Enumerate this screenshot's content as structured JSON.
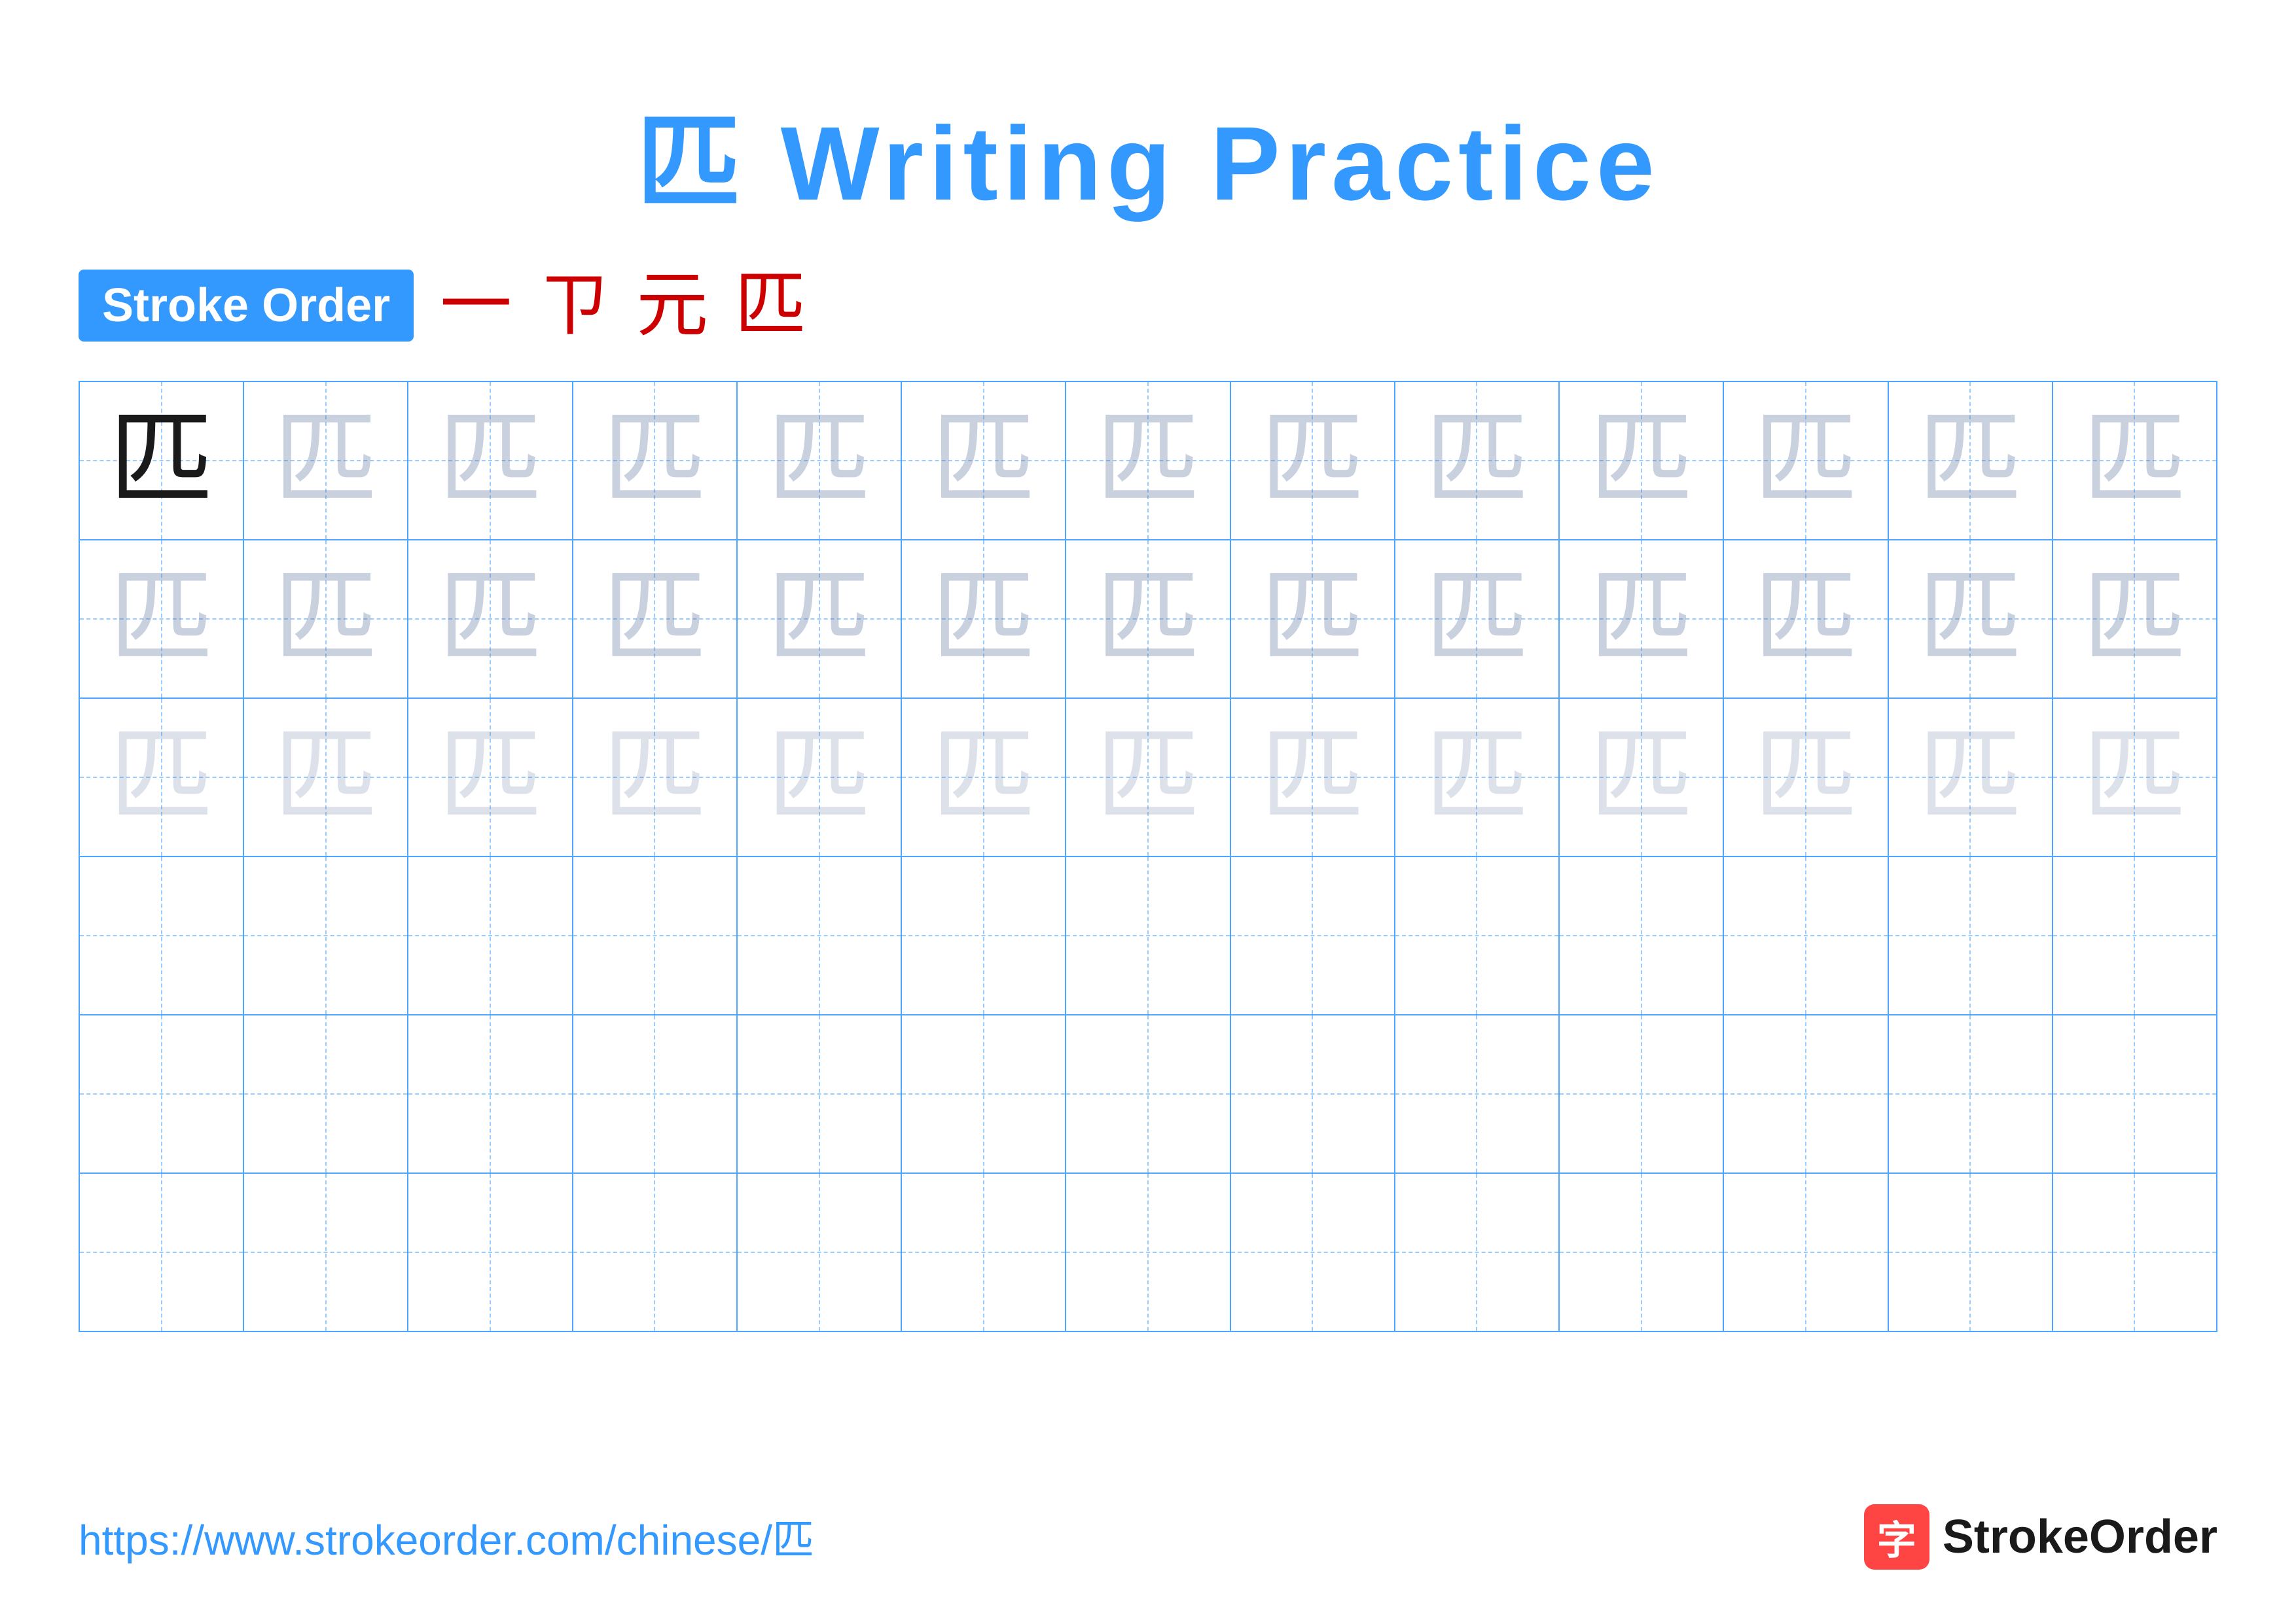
{
  "title": {
    "char": "匹",
    "label": "Writing Practice",
    "full": "匹 Writing Practice"
  },
  "stroke_order": {
    "badge_label": "Stroke Order",
    "steps": [
      "一",
      "ㄗ",
      "元",
      "匹"
    ]
  },
  "grid": {
    "rows": 6,
    "cols": 13,
    "char": "匹",
    "row_configs": [
      {
        "type": "dark_then_light1"
      },
      {
        "type": "light1"
      },
      {
        "type": "light2"
      },
      {
        "type": "empty"
      },
      {
        "type": "empty"
      },
      {
        "type": "empty"
      }
    ]
  },
  "footer": {
    "url": "https://www.strokeorder.com/chinese/匹",
    "brand_icon": "字",
    "brand_name": "StrokeOrder"
  }
}
